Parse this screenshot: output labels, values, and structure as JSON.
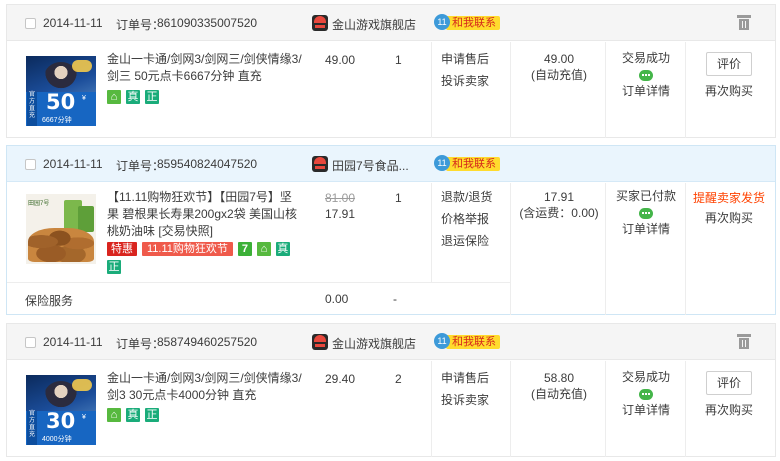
{
  "orders": [
    {
      "date": "2014-11-11",
      "order_label": "订单号：",
      "order_no": "861090335007520",
      "shop": "金山游戏旗舰店",
      "contact": "和我联系",
      "item": {
        "title": "金山一卡通/剑网3/剑网三/剑侠情缘3/剑三 50元点卡6667分钟 直充",
        "thumb_big": "50",
        "thumb_small": "6667分钟",
        "thumb_side": "官方直充",
        "price": "49.00",
        "qty": "1",
        "badge_true": "真",
        "badge_genuine": "正"
      },
      "actions": [
        "申请售后",
        "投诉卖家"
      ],
      "total": "49.00",
      "total_note": "(自动充值)",
      "status": "交易成功",
      "detail": "订单详情",
      "op_button": "评价",
      "op_link": "再次购买"
    },
    {
      "date": "2014-11-11",
      "order_label": "订单号：",
      "order_no": "859540824047520",
      "shop": "田园7号食品...",
      "contact": "和我联系",
      "item": {
        "title": "【11.11购物狂欢节】【田园7号】坚果 碧根果长寿果200gx2袋 美国山核桃奶油味 [交易快照]",
        "thumb_brand": "田园7号",
        "old_price": "81.00",
        "price": "17.91",
        "qty": "1",
        "badge_special": "特惠",
        "badge_sale": "11.11购物狂欢节",
        "badge_seven": "7",
        "badge_true": "真",
        "badge_genuine": "正"
      },
      "actions": [
        "退款/退货",
        "价格举报",
        "退运保险"
      ],
      "total": "17.91",
      "total_note": "(含运费：0.00)",
      "status": "买家已付款",
      "detail": "订单详情",
      "op_remind": "提醒卖家发货",
      "op_link": "再次购买",
      "service": {
        "label": "保险服务",
        "price": "0.00",
        "qty": "-"
      }
    },
    {
      "date": "2014-11-11",
      "order_label": "订单号：",
      "order_no": "858749460257520",
      "shop": "金山游戏旗舰店",
      "contact": "和我联系",
      "item": {
        "title": "金山一卡通/剑网3/剑网三/剑侠情缘3/剑3 30元点卡4000分钟 直充",
        "thumb_big": "30",
        "thumb_small": "4000分钟",
        "thumb_side": "官方直充",
        "price": "29.40",
        "qty": "2",
        "badge_true": "真",
        "badge_genuine": "正"
      },
      "actions": [
        "申请售后",
        "投诉卖家"
      ],
      "total": "58.80",
      "total_note": "(自动充值)",
      "status": "交易成功",
      "detail": "订单详情",
      "op_button": "评价",
      "op_link": "再次购买"
    }
  ],
  "icons": {
    "checkbox": "checkbox-icon",
    "shop": "tmall-shop-icon",
    "contact": "wangwang-contact-icon",
    "delete": "trash-icon",
    "wangwang_status": "wangwang-icon",
    "guarantee": "guarantee-icon"
  },
  "colors": {
    "contact_tag": "#ffdb2d",
    "contact_text": "#d6281c",
    "remind": "#ff4200",
    "highlight_header": "#eaf5fd"
  }
}
